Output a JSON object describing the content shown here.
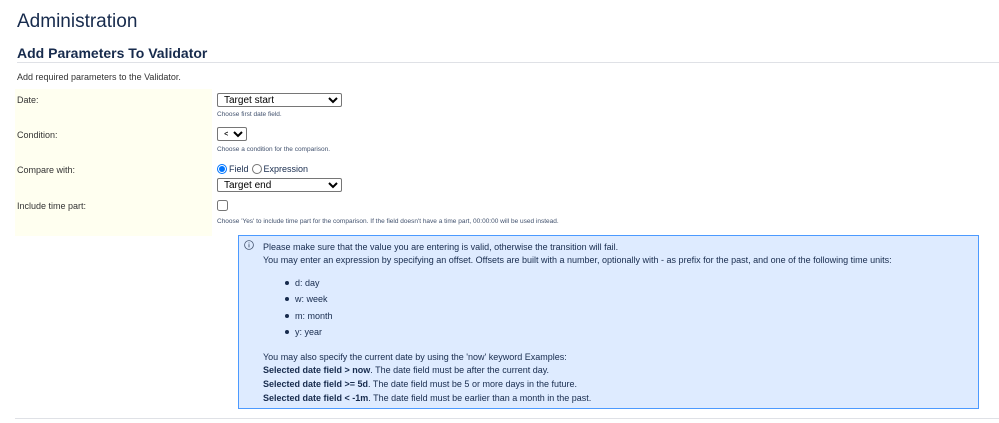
{
  "page": {
    "title": "Administration"
  },
  "section": {
    "title": "Add Parameters To Validator",
    "intro": "Add required parameters to the Validator."
  },
  "form": {
    "date": {
      "label": "Date:",
      "selected": "Target start",
      "description": "Choose first date field."
    },
    "condition": {
      "label": "Condition:",
      "selected": "<",
      "description": "Choose a condition for the comparison."
    },
    "compare_with": {
      "label": "Compare with:",
      "options": [
        {
          "label": "Field",
          "checked": true
        },
        {
          "label": "Expression",
          "checked": false
        }
      ],
      "selected_field": "Target end"
    },
    "include_time": {
      "label": "Include time part:",
      "checked": false,
      "description": "Choose 'Yes' to include time part for the comparison. If the field doesn't have a time part, 00:00:00 will be used instead."
    }
  },
  "info": {
    "icon": "info-circle-icon",
    "line1": "Please make sure that the value you are entering is valid, otherwise the transition will fail.",
    "line2": "You may enter an expression by specifying an offset. Offsets are built with a number, optionally with - as prefix for the past, and one of the following time units:",
    "units": [
      "d: day",
      "w: week",
      "m: month",
      "y: year"
    ],
    "line3": "You may also specify the current date by using the 'now' keyword Examples:",
    "examples": [
      {
        "bold": "Selected date field > now",
        "text": ". The date field must be after the current day."
      },
      {
        "bold": "Selected date field >= 5d",
        "text": ". The date field must be 5 or more days in the future."
      },
      {
        "bold": "Selected date field < -1m",
        "text": ". The date field must be earlier than a month in the past."
      }
    ]
  },
  "colors": {
    "label_bg": "#fffff0",
    "info_bg": "#deebff",
    "info_border": "#4c9aff",
    "text": "#172b4d"
  }
}
